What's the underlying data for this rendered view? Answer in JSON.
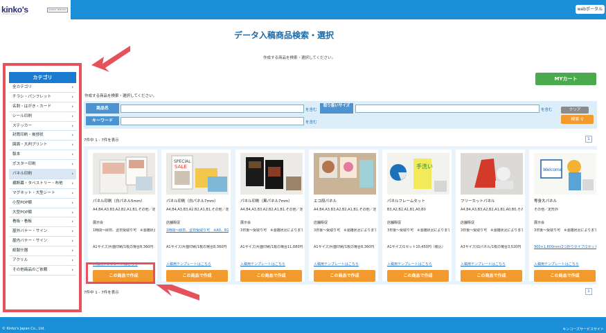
{
  "header": {
    "logo": "kinko's",
    "logo_sub": "Kinko's Japan Co., Ltd.",
    "logo_mark": "KONICA MINOLTA",
    "webportal": "webポータル"
  },
  "page": {
    "title": "データ入稿商品検索・選択",
    "subtitle": "作成する商品を検索・選択してください。"
  },
  "sidebar": {
    "heading": "カテゴリ",
    "items": [
      "全カテゴリ",
      "チラシ・パンフレット",
      "名刺・はがき・カード",
      "シール印刷",
      "ステッカー",
      "封筒印刷・挨拶状",
      "図面・大判プリント",
      "製本",
      "ポスター印刷",
      "パネル印刷",
      "横断幕・タペストリー・布他",
      "マグネット・大型シート",
      "小型POP類",
      "大型POP類",
      "看板・看板",
      "屋外バナー・サイン",
      "屋内バナー・サイン",
      "紙製什器",
      "アクリル",
      "その他商品のご依頼"
    ],
    "active_index": 9
  },
  "cart": {
    "label": "MYカート"
  },
  "search": {
    "note": "作成する商品を検索・選択してください。",
    "product_label": "商品名",
    "keyword_label": "キーワード",
    "size_label": "取り扱いサイズ",
    "contains": "を含む",
    "clear": "クリア",
    "search": "検索"
  },
  "results": {
    "count": "7件中 1 - 7件を表示",
    "page": "1"
  },
  "products": [
    {
      "name": "パネル印刷（白パネル5mm）",
      "size": "A4,B4,A3,B3,A2,B2,A1,B1,その他／定形外",
      "note": "展示会",
      "delivery": "1時間〜即日、翌日受取り可　※混雑状況によります",
      "price": "A1サイズ/片面印刷/1枚の場合8,360円（税込）",
      "template": "入稿用テンプレートはこちら",
      "button": "この商品で作成"
    },
    {
      "name": "パネル印刷（白パネル7mm）",
      "size": "A4,B4,A3,B3,A2,B2,A1,B1,その他／定形外",
      "note": "店舗販促",
      "delivery": "1時間〜即日、翌日受取り可　※A0、B1、B0は要相談…",
      "price": "A1サイズ/片面印刷/1枚の場合8,360円（税込）",
      "template": "入稿用テンプレートはこちら",
      "button": "この商品で作成"
    },
    {
      "name": "パネル印刷（黒パネル7mm）",
      "size": "A4,B4,A3,B3,A2,B2,A1,B1,その他／定形外",
      "note": "展示会",
      "delivery": "3日後〜受取り可　※混雑状況によります",
      "price": "A1サイズ/片面印刷/1枚の場合11,680円（税込）",
      "template": "入稿用テンプレートはこちら",
      "button": "この商品で作成"
    },
    {
      "name": "エコ段パネル",
      "size": "A4,B4,A3,B3,A2,B2,A1,B1,その他／定形外",
      "note": "店舗販促",
      "delivery": "3日後〜受取り可　※混雑状況によります",
      "price": "A1サイズ/片面印刷/1枚の場合8,360円（税込）",
      "template": "入稿用テンプレートはこちら",
      "button": "この商品で作成"
    },
    {
      "name": "パネルフレームセット",
      "size": "B3,A2,B2,A1,B1,A0,B0",
      "note": "店舗販促",
      "delivery": "3日後〜受取り可　※混雑状況によります",
      "price": "A1サイズ/1セット10,450円（税込）",
      "template": "入稿用テンプレートはこちら",
      "button": "この商品で作成"
    },
    {
      "name": "フリーカットパネル",
      "size": "A4,B4,A3,B3,A2,B2,A1,B1,A0,B0,その他／定形外",
      "note": "店舗販促",
      "delivery": "3日後〜受取り可　※混雑状況によります",
      "price": "A3サイズ/白パネル/1枚の場合3,520円（税込）",
      "template": "入稿用テンプレートはこちら",
      "button": "この商品で作成"
    },
    {
      "name": "等身大パネル",
      "size": "その他／定形外",
      "note": "展示会",
      "delivery": "3日後〜受取り可　※混雑状況によります",
      "price": "900×1,800mm/2つ折りタイプ/1セット19,5…",
      "template": "入稿用テンプレートはこちら",
      "button": "この商品で作成"
    }
  ],
  "footer": {
    "copyright": "© Kinko's Japan Co., Ltd.",
    "right": "キンコーズサービスサイト"
  }
}
